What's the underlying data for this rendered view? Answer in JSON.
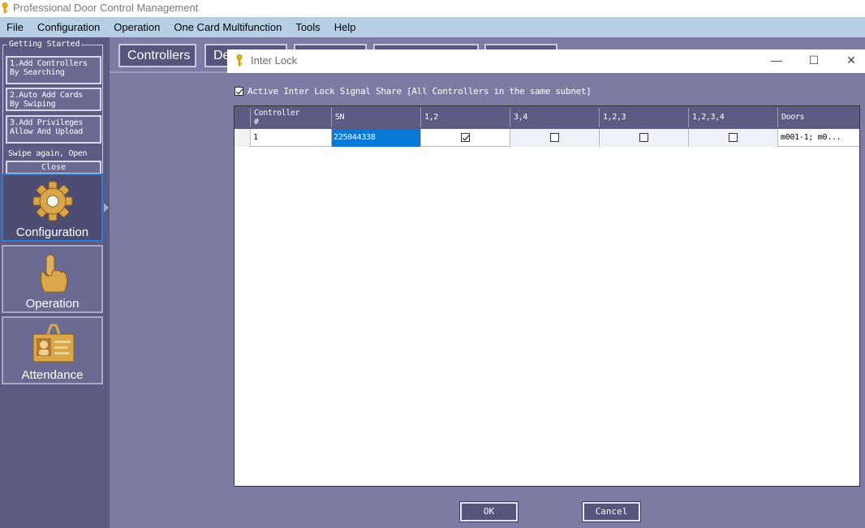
{
  "app": {
    "title": "Professional Door Control Management"
  },
  "menu": [
    "File",
    "Configuration",
    "Operation",
    "One Card Multifunction",
    "Tools",
    "Help"
  ],
  "getting_started": {
    "legend": "Getting Started",
    "steps": [
      [
        "1.Add Controllers",
        "By Searching"
      ],
      [
        "2.Auto Add Cards",
        "By Swiping"
      ],
      [
        "3.Add Privileges",
        "Allow And Upload"
      ]
    ],
    "note": "Swipe again, Open",
    "close": "Close"
  },
  "nav": [
    {
      "label": "Configuration",
      "icon": "gear-icon",
      "active": true
    },
    {
      "label": "Operation",
      "icon": "hand-pointer-icon",
      "active": false
    },
    {
      "label": "Attendance",
      "icon": "id-card-icon",
      "active": false
    }
  ],
  "top_tabs": {
    "controllers": "Controllers",
    "second_partial": "De"
  },
  "dialog": {
    "title": "Inter Lock",
    "share_checkbox": {
      "label": "Active Inter Lock Signal Share [All Controllers in the same subnet]",
      "checked": true
    },
    "columns": [
      [
        "Controller",
        "#"
      ],
      [
        "SN"
      ],
      [
        "1,2"
      ],
      [
        "3,4"
      ],
      [
        "1,2,3"
      ],
      [
        "1,2,3,4"
      ],
      [
        "Doors"
      ]
    ],
    "rows": [
      {
        "controller": "1",
        "sn": "225044338",
        "c12": true,
        "c34": false,
        "c123": false,
        "c1234": false,
        "doors": "m001-1;   m0..."
      }
    ],
    "ok": "OK",
    "cancel": "Cancel"
  }
}
